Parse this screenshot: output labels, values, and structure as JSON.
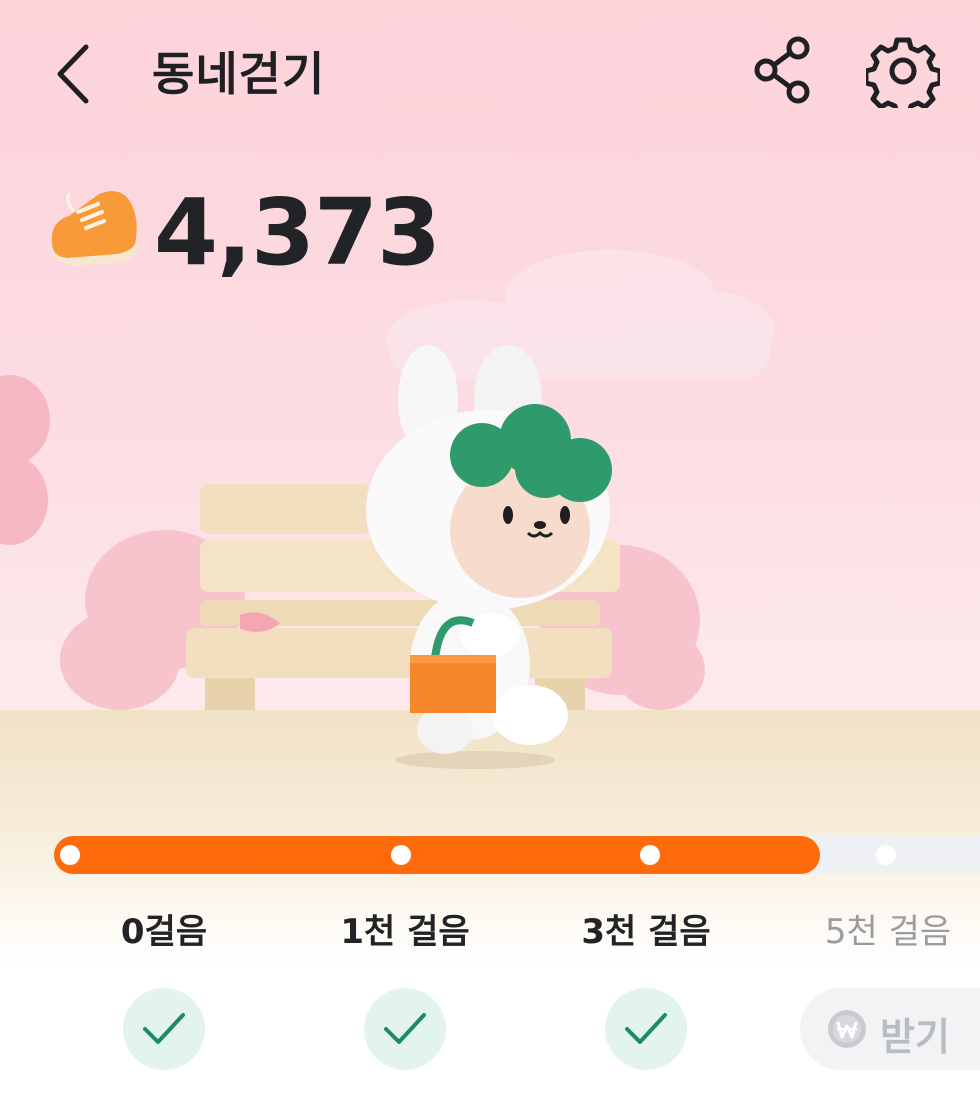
{
  "header": {
    "title": "동네걷기",
    "back_icon": "chevron-left-icon",
    "share_icon": "share-icon",
    "settings_icon": "gear-icon"
  },
  "steps": {
    "icon": "shoe-icon",
    "count": "4,373"
  },
  "progress": {
    "fill_fraction": 0.827,
    "fill_color": "#ff6a0b",
    "milestones": [
      {
        "label": "0걸음",
        "achieved": true
      },
      {
        "label": "1천 걸음",
        "achieved": true
      },
      {
        "label": "3천 걸음",
        "achieved": true
      },
      {
        "label": "5천 걸음",
        "achieved": false
      }
    ]
  },
  "rewards": {
    "check_icon": "check-icon",
    "claim_label": "받기",
    "claim_icon": "won-coin-icon"
  },
  "colors": {
    "accent": "#ff6a0b",
    "check": "#1d8a6b",
    "check_bg": "#e3f4ef",
    "disabled_text": "#b9bcc1"
  }
}
